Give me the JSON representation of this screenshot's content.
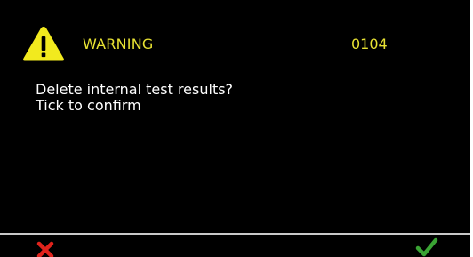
{
  "dialog": {
    "title": "WARNING",
    "code": "0104",
    "message_lines": [
      "Delete internal test results?",
      "Tick to confirm"
    ]
  },
  "icons": {
    "warning": "warning-triangle-icon",
    "cancel": "cross-icon",
    "confirm": "checkmark-icon"
  },
  "colors": {
    "background": "#000000",
    "title_text": "#e8e233",
    "message_text": "#ffffff",
    "warning_icon_fill": "#f2ea1e",
    "cancel_icon": "#e0231c",
    "confirm_icon": "#3aa334",
    "divider": "#c8c8c8"
  }
}
